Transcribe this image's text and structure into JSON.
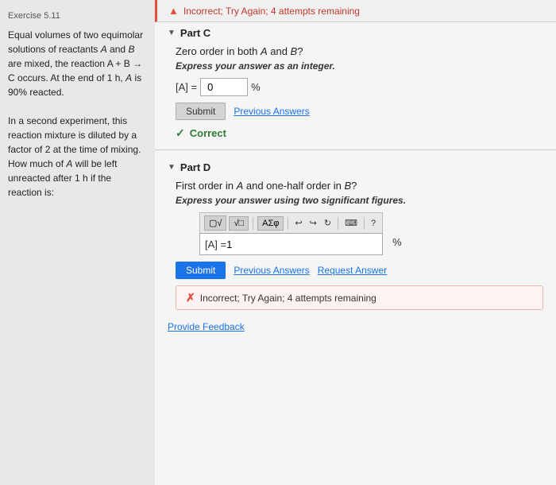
{
  "exercise": {
    "label": "Exercise 5.11",
    "description": "Equal volumes of two equimolar solutions of reactants A and B are mixed, the reaction A + B → C occurs. At the end of 1 h, A is 90% reacted.\nIn a second experiment, this reaction mixture is diluted by a factor of 2 at the time of mixing. How much of A will be left unreacted after 1 h if the reaction is:"
  },
  "top_banner": {
    "icon": "✗",
    "text": "Incorrect; Try Again; 4 attempts remaining"
  },
  "part_c": {
    "label": "Part C",
    "question": "Zero order in both A and B?",
    "instruction": "Express your answer as an integer.",
    "input_label": "[A] =",
    "input_value": "0",
    "unit": "%",
    "submit_label": "Submit",
    "previous_answers_label": "Previous Answers",
    "correct_text": "Correct",
    "check_icon": "✓"
  },
  "part_d": {
    "label": "Part D",
    "question": "First order in A and one-half order in B?",
    "instruction": "Express your answer using two significant figures.",
    "toolbar": {
      "sqrt_label": "√□",
      "sigma_label": "ΑΣφ",
      "undo_icon": "↩",
      "redo_icon": "↪",
      "refresh_icon": "↺",
      "keyboard_icon": "⌨",
      "help_icon": "?"
    },
    "input_label": "[A] =",
    "input_value": "1",
    "unit": "%",
    "submit_label": "Submit",
    "previous_answers_label": "Previous Answers",
    "request_answer_label": "Request Answer",
    "incorrect_icon": "✗",
    "incorrect_text": "Incorrect; Try Again; 4 attempts remaining"
  },
  "footer": {
    "provide_feedback": "Provide Feedback"
  }
}
